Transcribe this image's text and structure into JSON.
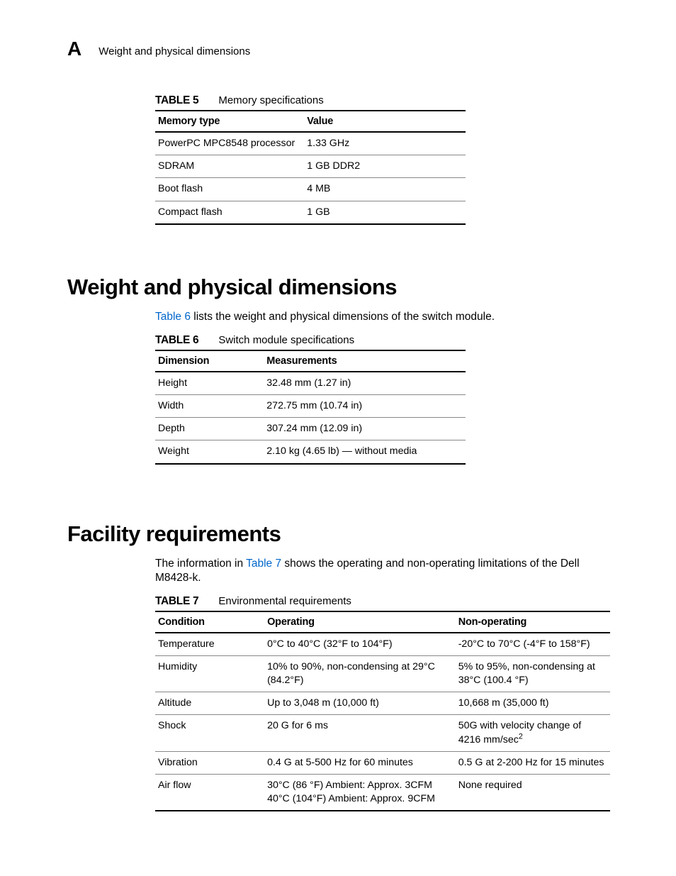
{
  "header": {
    "letter": "A",
    "text": "Weight and physical dimensions"
  },
  "table5": {
    "label": "TABLE 5",
    "caption": "Memory specifications",
    "headers": [
      "Memory type",
      "Value"
    ],
    "rows": [
      [
        "PowerPC MPC8548 processor",
        "1.33 GHz"
      ],
      [
        "SDRAM",
        "1 GB DDR2"
      ],
      [
        "Boot flash",
        "4 MB"
      ],
      [
        "Compact flash",
        "1 GB"
      ]
    ]
  },
  "section_weight": {
    "title": "Weight and physical dimensions",
    "intro_link": "Table 6",
    "intro_rest": " lists the weight and physical dimensions of the switch module."
  },
  "table6": {
    "label": "TABLE 6",
    "caption": "Switch module specifications",
    "headers": [
      "Dimension",
      "Measurements"
    ],
    "rows": [
      [
        "Height",
        "32.48 mm (1.27 in)"
      ],
      [
        "Width",
        "272.75 mm (10.74 in)"
      ],
      [
        "Depth",
        "307.24 mm (12.09 in)"
      ],
      [
        "Weight",
        "2.10 kg (4.65 lb) — without media"
      ]
    ]
  },
  "section_facility": {
    "title": "Facility requirements",
    "intro_pre": "The information in ",
    "intro_link": "Table 7",
    "intro_post": " shows the operating and non-operating limitations of the Dell M8428-k."
  },
  "table7": {
    "label": "TABLE 7",
    "caption": "Environmental requirements",
    "headers": [
      "Condition",
      "Operating",
      "Non-operating"
    ],
    "rows": [
      [
        "Temperature",
        "0°C to 40°C (32°F to 104°F)",
        "-20°C to 70°C (-4°F to 158°F)"
      ],
      [
        "Humidity",
        "10% to 90%, non-condensing at 29°C (84.2°F)",
        "5% to 95%, non-condensing at 38°C (100.4 °F)"
      ],
      [
        "Altitude",
        "Up to 3,048 m (10,000 ft)",
        "10,668 m (35,000 ft)"
      ],
      [
        "Shock",
        "20 G for 6 ms",
        "50G with velocity change of 4216 mm/sec²"
      ],
      [
        "Vibration",
        "0.4 G at 5-500 Hz for 60 minutes",
        "0.5 G at 2-200 Hz for 15 minutes"
      ],
      [
        "Air flow",
        "30°C (86 °F) Ambient: Approx. 3CFM 40°C (104°F) Ambient: Approx. 9CFM",
        "None required"
      ]
    ]
  }
}
